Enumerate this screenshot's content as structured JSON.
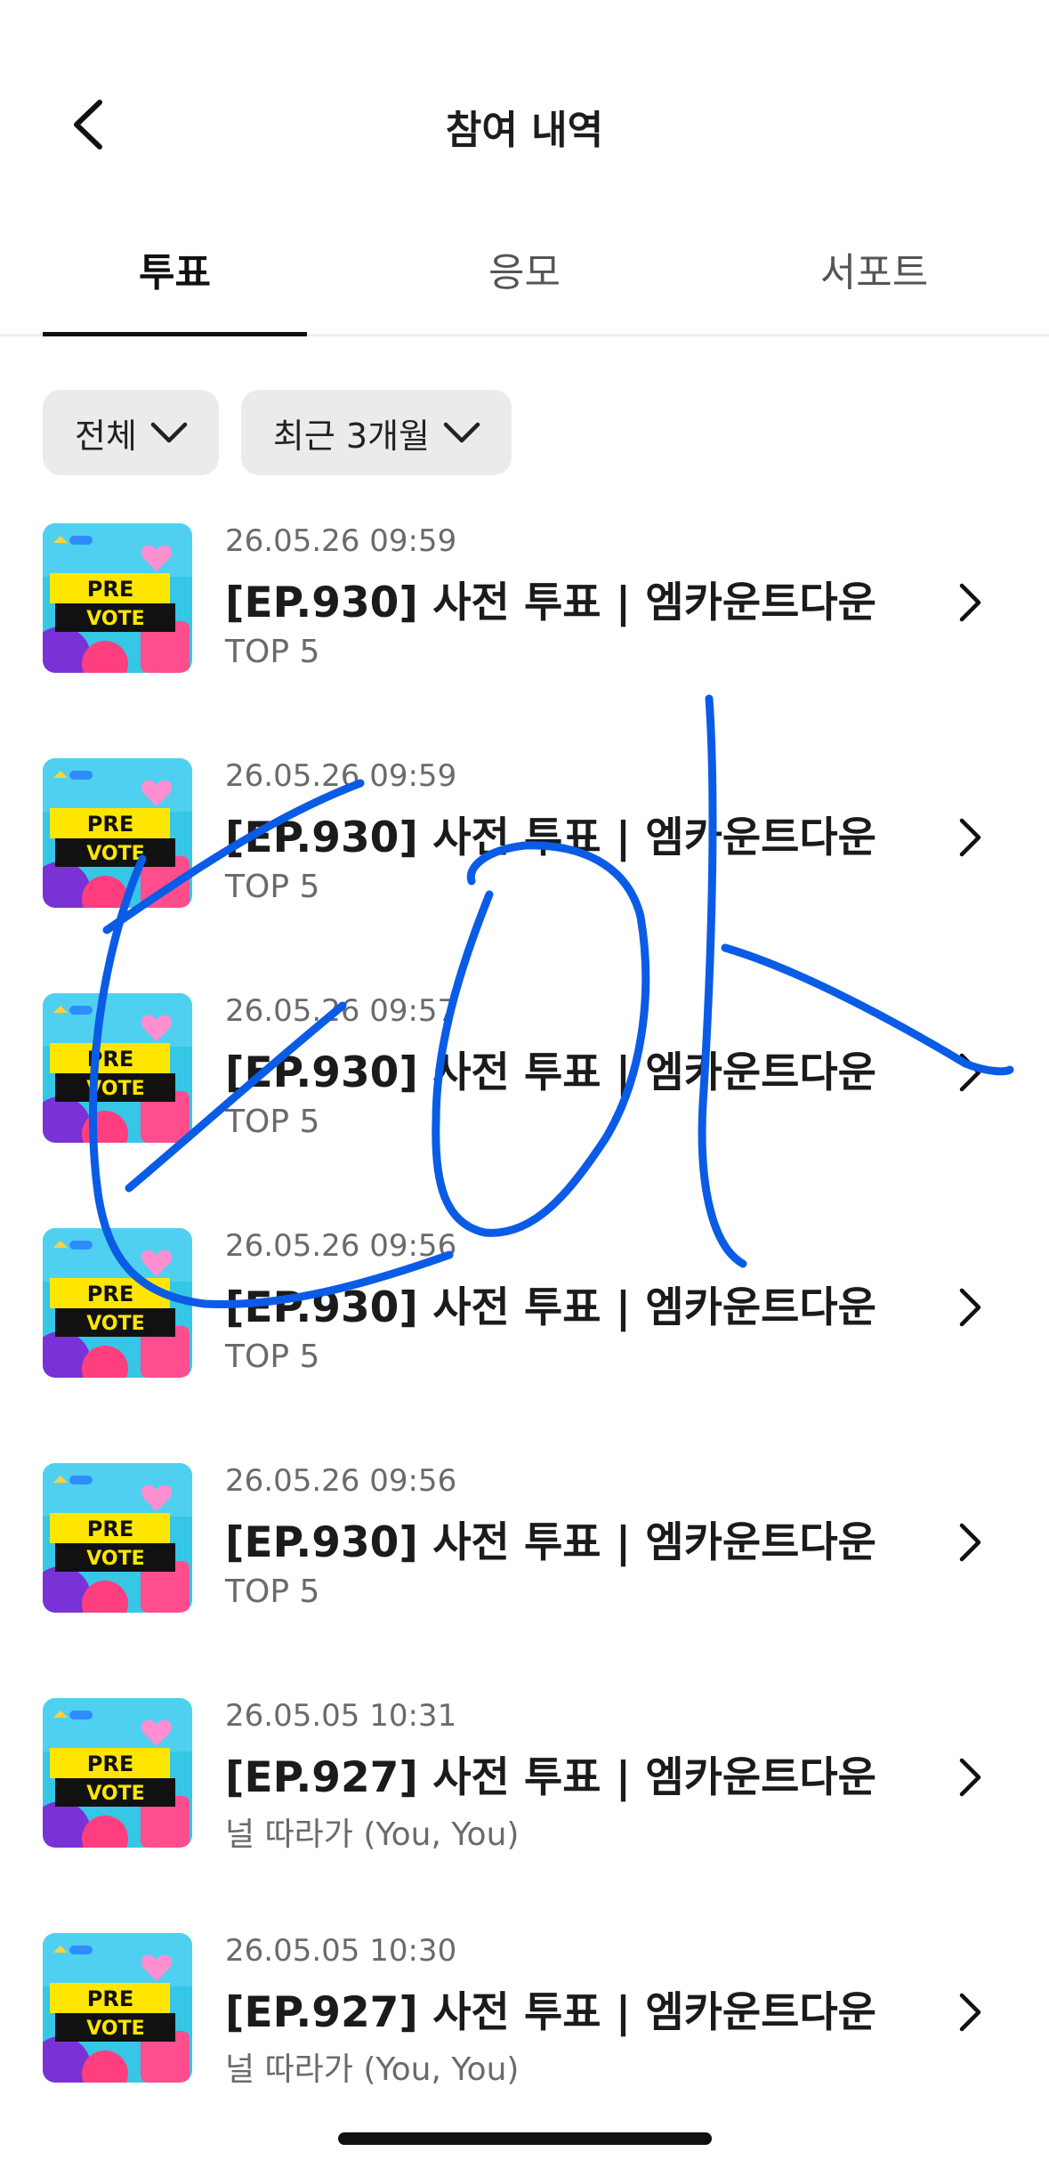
{
  "header": {
    "title": "참여 내역"
  },
  "tabs": [
    {
      "label": "투표",
      "active": true
    },
    {
      "label": "응모",
      "active": false
    },
    {
      "label": "서포트",
      "active": false
    }
  ],
  "filters": [
    {
      "label": "전체"
    },
    {
      "label": "최근 3개월"
    }
  ],
  "thumbnail_text": {
    "line1": "PRE",
    "line2": "VOTE"
  },
  "items": [
    {
      "date": "26.05.26 09:59",
      "title": "[EP.930] 사전 투표 | 엠카운트다운",
      "subtitle": "TOP 5"
    },
    {
      "date": "26.05.26 09:59",
      "title": "[EP.930] 사전 투표 | 엠카운트다운",
      "subtitle": "TOP 5"
    },
    {
      "date": "26.05.26 09:57",
      "title": "[EP.930] 사전 투표 | 엠카운트다운",
      "subtitle": "TOP 5"
    },
    {
      "date": "26.05.26 09:56",
      "title": "[EP.930] 사전 투표 | 엠카운트다운",
      "subtitle": "TOP 5"
    },
    {
      "date": "26.05.26 09:56",
      "title": "[EP.930] 사전 투표 | 엠카운트다운",
      "subtitle": "TOP 5"
    },
    {
      "date": "26.05.05 10:31",
      "title": "[EP.927] 사전 투표 | 엠카운트다운",
      "subtitle": "널 따라가 (You, You)"
    },
    {
      "date": "26.05.05 10:30",
      "title": "[EP.927] 사전 투표 | 엠카운트다운",
      "subtitle": "널 따라가 (You, You)"
    }
  ],
  "colors": {
    "accent": "#111111",
    "chip_bg": "#ebebed",
    "annotation": "#0a5ce6"
  }
}
